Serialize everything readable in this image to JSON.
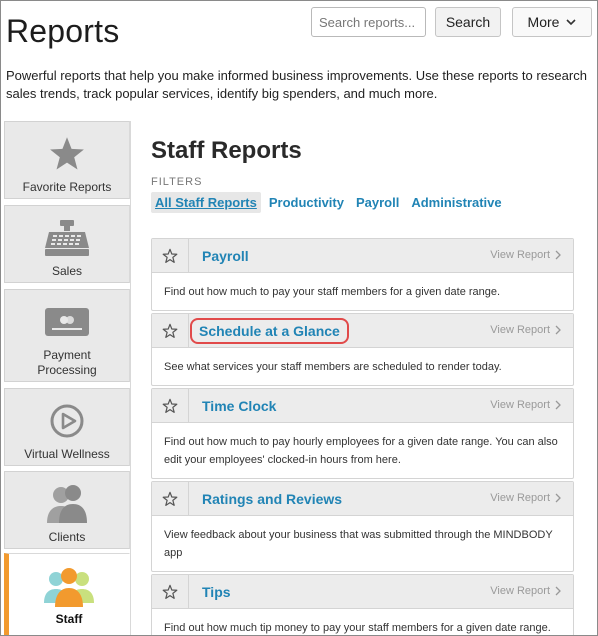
{
  "header": {
    "title": "Reports",
    "search_placeholder": "Search reports...",
    "search_label": "Search",
    "more_label": "More"
  },
  "intro": "Powerful reports that help you make informed business improvements. Use these reports to research sales trends, track popular services, identify big spenders, and much more.",
  "sidebar": {
    "items": [
      {
        "label": "Favorite Reports",
        "icon": "star-icon"
      },
      {
        "label": "Sales",
        "icon": "cash-register-icon"
      },
      {
        "label": "Payment Processing",
        "icon": "credit-card-icon"
      },
      {
        "label": "Virtual Wellness",
        "icon": "play-circle-icon"
      },
      {
        "label": "Clients",
        "icon": "clients-icon"
      },
      {
        "label": "Staff",
        "icon": "staff-icon"
      }
    ]
  },
  "main": {
    "title": "Staff Reports",
    "filters_label": "FILTERS",
    "filters": [
      "All Staff Reports",
      "Productivity",
      "Payroll",
      "Administrative"
    ],
    "view_label": "View Report",
    "reports": [
      {
        "title": "Payroll",
        "desc": "Find out how much to pay your staff members for a given date range."
      },
      {
        "title": "Schedule at a Glance",
        "desc": "See what services your staff members are scheduled to render today."
      },
      {
        "title": "Time Clock",
        "desc": "Find out how much to pay hourly employees for a given date range. You can also edit your employees' clocked-in hours from here."
      },
      {
        "title": "Ratings and Reviews",
        "desc": "View feedback about your business that was submitted through the MINDBODY app"
      },
      {
        "title": "Tips",
        "desc": "Find out how much tip money to pay your staff members for a given date range."
      }
    ]
  },
  "colors": {
    "link": "#2184b5",
    "active_accent": "#f29a2e",
    "highlight": "#e14a4a"
  }
}
